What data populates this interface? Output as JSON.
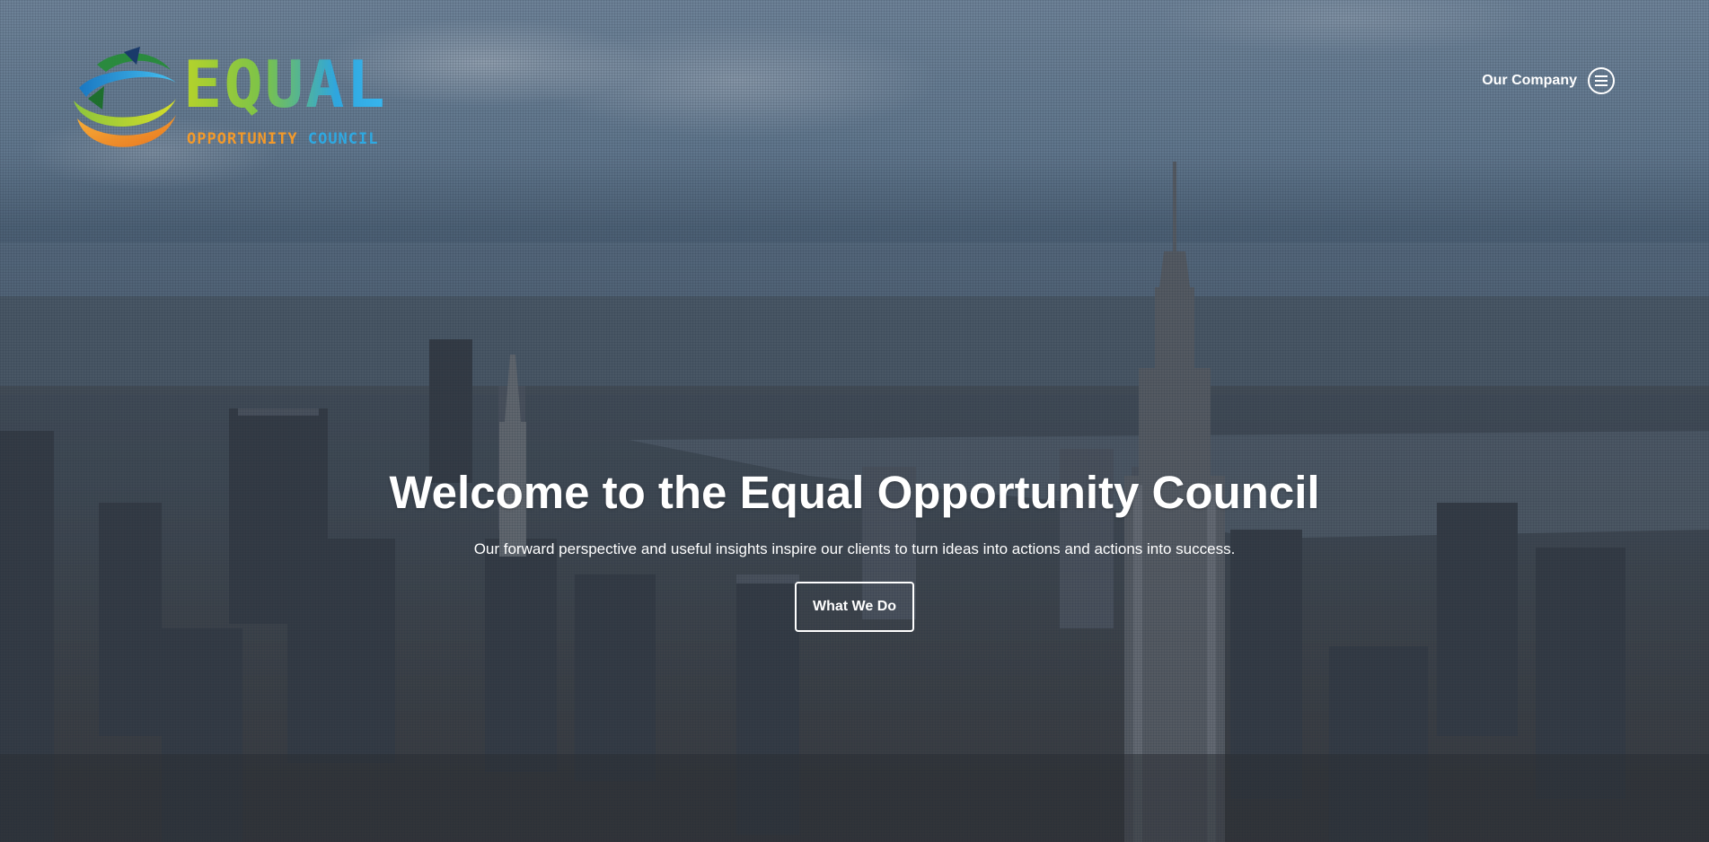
{
  "page": {
    "title": "Equal Opportunity Council"
  },
  "logo": {
    "wordmark": "EQUAL",
    "tagline_word1": "OPPORTUNITY",
    "tagline_word2": "COUNCIL",
    "icon": "circular-arrows-icon",
    "colors": {
      "green": "#7ac24a",
      "lime": "#b6d32a",
      "blue": "#2fa6de",
      "orange": "#f39a2a"
    }
  },
  "nav": {
    "menu_label": "Our Company",
    "menu_icon": "hamburger-icon"
  },
  "hero": {
    "title": "Welcome to the Equal Opportunity Council",
    "subtitle": "Our forward perspective and useful insights inspire our clients to turn ideas into actions and actions into success.",
    "cta_label": "What We Do",
    "background": "aerial-city-skyline-image"
  }
}
